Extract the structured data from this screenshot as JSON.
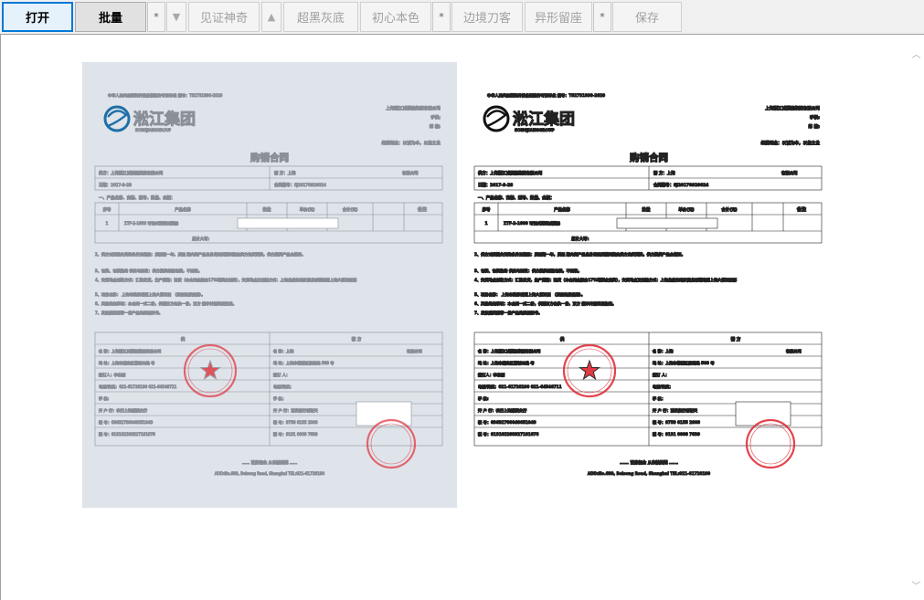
{
  "toolbar": {
    "open": "打开",
    "batch": "批量",
    "star1": "*",
    "star2": "*",
    "star3": "*",
    "down": "▼",
    "up": "▲",
    "witness": "见证神奇",
    "super_black_gray": "超黑灰底",
    "original_color": "初心本色",
    "edge_knife": "边境刀客",
    "irregular_margin": "异形留座",
    "save": "保存"
  },
  "colors": {
    "accent": "#0078d7",
    "scan_bg": "#dfe4ea",
    "stamp_red": "#e0303a"
  },
  "document": {
    "license": "中华人民共和国特种设备制造许可证单位 编号：TS2731890-2020",
    "logo_cn": "淞江集团",
    "logo_en": "SONGJIANGGROUP",
    "company_header": "上海淞江减震器集团有限公司",
    "phone_label": "手机:",
    "post_label": "邮 箱:",
    "motto": "经营理念：以诚为本，以信立业",
    "title": "购销合同",
    "supplier": "供方：上海淞江减震器集团有限公司",
    "buyer_label": "需  方：上海",
    "buyer_suffix": "有限公司",
    "date": "日期：2017-9-28",
    "contract_no": "合同编号：SJ20170928024",
    "section1": "一、产品名称、商标、型号、数量、金额：",
    "col_no": "序号",
    "col_name": "产品名称",
    "col_qty": "数量",
    "col_price": "单价(元)",
    "col_total": "合计(元)",
    "col_remark": "备注",
    "row_no": "1",
    "row_product": "ZTF-2-1600 可调式弹簧减震器",
    "sum_caps": "总计大写:",
    "term2": "2、供方对质量负责的条件及期限：质保期一年，质保 期内如产品自身出现质量问题由供方免费更换，供方提供产品合格证。",
    "term3": "3、包装、包装物的 供应与回收：供方提供纸箱包装，不回收。",
    "term4": "4、交货地点付款方式：汇款发货，生产周期：现货（本合同金额含17%增票含运费），交货地点及运输方式：上海龙盛东路汉庭龙城福路道上海大厦项目部",
    "term5": "5、项目名称：        上海市陆家嘴道上海大厦项目                    （质保售后备案）。",
    "term6": "6、其他约定事项：本合同一式二份，供需双方各执一份，双方 签字并盖章后生效。",
    "term7": "7、发放随货附带一份产品的质保证书。",
    "party_supply": "供",
    "party_demand": "需    方",
    "s_name": "名  称：上海淞江减震器集团有限公司",
    "s_addr": "地  址：上海市嘉定区曹新公路 号",
    "s_signer": "签订人：李东刚",
    "s_tel": "电话/传真：021-61728190   021-64546711",
    "s_mobile": "手  机:",
    "s_bank": "开 户 行：农行上海酬溪支行",
    "s_account": "帐    号：03632700040051040",
    "s_tax": "税    号：913102203327181076",
    "d_name": "名    称：上海",
    "d_suffix": "有限公司",
    "d_addr": "地  址：上海市杨浦区殷路路 588 号",
    "d_signer": "签订 人：",
    "d_tel": "电话/传真：",
    "d_mobile": "手    机：",
    "d_bank": "开 户 行：浦发银行创智天",
    "d_account": "帐    号：9759 0155 2000",
    "d_tax": "税    号：9131 0000 7639",
    "footer1": "...... 首席佣金  从未被超越 ......",
    "footer2": "ADD:No.699, Beisong Road, Shanghai    TEL:021-61728190"
  }
}
